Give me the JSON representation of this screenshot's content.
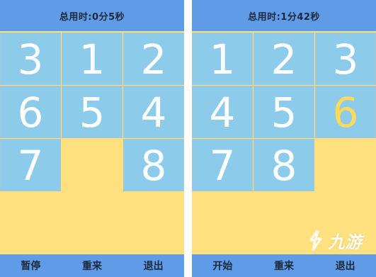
{
  "left_game": {
    "timer_text": "总用时:0分5秒",
    "tiles": [
      "3",
      "1",
      "2",
      "6",
      "5",
      "4",
      "7",
      "",
      "8"
    ],
    "buttons": {
      "pause": "暂停",
      "restart": "重来",
      "exit": "退出"
    }
  },
  "right_game": {
    "timer_text": "总用时:1分42秒",
    "tiles": [
      "1",
      "2",
      "3",
      "4",
      "5",
      "6",
      "7",
      "8",
      ""
    ],
    "highlighted_tile": "6",
    "buttons": {
      "start": "开始",
      "restart": "重来",
      "exit": "退出"
    }
  },
  "watermark": {
    "text": "九游",
    "icon": "jiuyou-logo-icon"
  },
  "colors": {
    "header_footer_bg": "#5f9be6",
    "tile_bg": "#8ccbea",
    "board_bg": "#ffe07e",
    "tile_text": "#ffffff",
    "tile_highlight_text": "#ffd95a"
  }
}
